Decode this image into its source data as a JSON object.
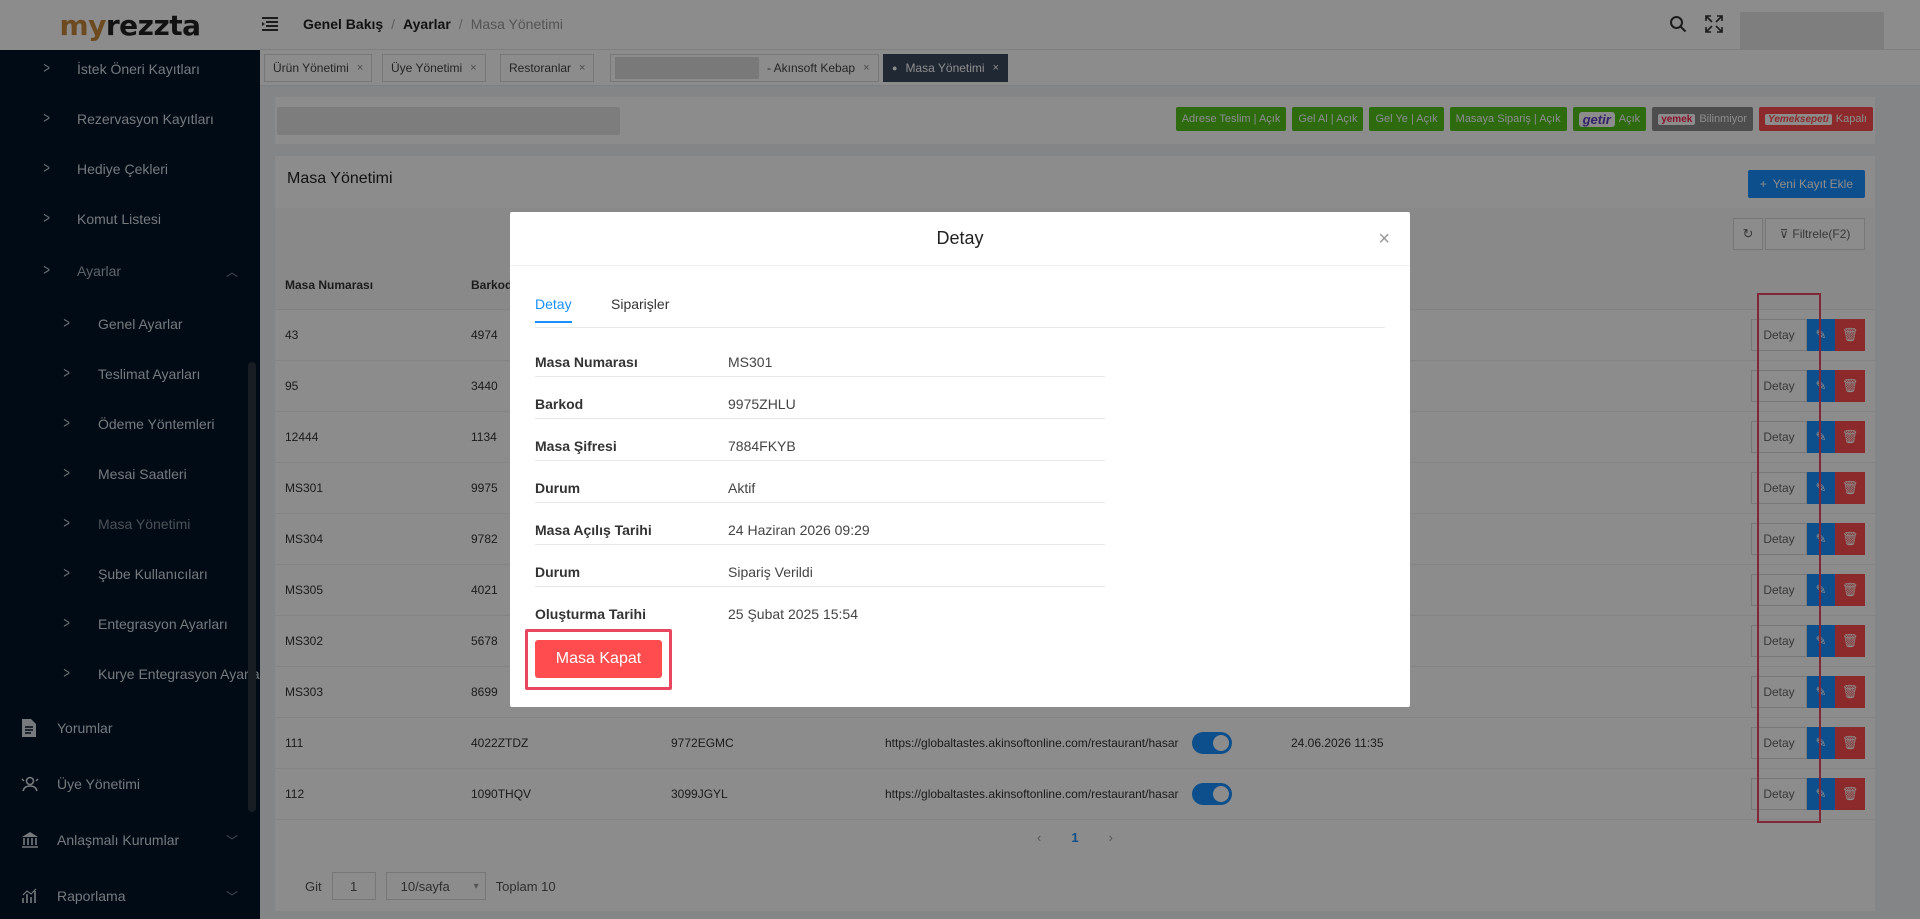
{
  "app": {
    "logo_part1": "my",
    "logo_part2": "rezzta"
  },
  "breadcrumb": [
    "Genel Bakış",
    "Ayarlar",
    "Masa Yönetimi"
  ],
  "sidebar": {
    "items": [
      {
        "label": "İstek Öneri Kayıtları"
      },
      {
        "label": "Rezervasyon Kayıtları"
      },
      {
        "label": "Hediye Çekleri"
      },
      {
        "label": "Komut Listesi"
      },
      {
        "label": "Ayarlar"
      },
      {
        "label": "Genel Ayarlar"
      },
      {
        "label": "Teslimat Ayarları"
      },
      {
        "label": "Ödeme Yöntemleri"
      },
      {
        "label": "Mesai Saatleri"
      },
      {
        "label": "Masa Yönetimi"
      },
      {
        "label": "Şube Kullanıcıları"
      },
      {
        "label": "Entegrasyon Ayarları"
      },
      {
        "label": "Kurye Entegrasyon Ayarları"
      },
      {
        "label": "Yorumlar"
      },
      {
        "label": "Üye Yönetimi"
      },
      {
        "label": "Anlaşmalı Kurumlar"
      },
      {
        "label": "Raporlama"
      }
    ]
  },
  "tabs": [
    {
      "label": "Ürün Yönetimi"
    },
    {
      "label": "Üye Yönetimi"
    },
    {
      "label": "Restoranlar"
    },
    {
      "label": "- Akınsoft Kebap"
    },
    {
      "label": "Masa Yönetimi"
    }
  ],
  "status_badges": [
    {
      "label": "Adrese Teslim | Açık",
      "color": "#52c41a"
    },
    {
      "label": "Gel Al | Açık",
      "color": "#52c41a"
    },
    {
      "label": "Gel Ye | Açık",
      "color": "#52c41a"
    },
    {
      "label": "Masaya Sipariş | Açık",
      "color": "#52c41a"
    },
    {
      "logo": "getir",
      "label": "Açık",
      "color": "#52c41a"
    },
    {
      "logo": "yemek",
      "label": "Bilinmiyor",
      "color": "#8c8c8c"
    },
    {
      "logo": "Yemeksepeti",
      "label": "Kapalı",
      "color": "#ff4d4f"
    }
  ],
  "page": {
    "title": "Masa Yönetimi",
    "add_button": "Yeni Kayıt Ekle",
    "filter_button": "Filtrele(F2)"
  },
  "table": {
    "headers": [
      "Masa Numarası",
      "Barkod"
    ],
    "rows": [
      {
        "no": "43",
        "barkod": "4974"
      },
      {
        "no": "95",
        "barkod": "3440"
      },
      {
        "no": "12444",
        "barkod": "1134"
      },
      {
        "no": "MS301",
        "barkod": "9975"
      },
      {
        "no": "MS304",
        "barkod": "9782"
      },
      {
        "no": "MS305",
        "barkod": "4021"
      },
      {
        "no": "MS302",
        "barkod": "5678"
      },
      {
        "no": "MS303",
        "barkod": "8699"
      },
      {
        "no": "111",
        "barkod": "4022ZTDZ",
        "sifre": "9772EGMC",
        "url": "https://globaltastes.akinsoftonline.com/restaurant/hasar",
        "date": "24.06.2026 11:35"
      },
      {
        "no": "112",
        "barkod": "1090THQV",
        "sifre": "3099JGYL",
        "url": "https://globaltastes.akinsoftonline.com/restaurant/hasar",
        "date": ""
      }
    ],
    "detail_label": "Detay"
  },
  "pagination": {
    "current": "1",
    "goto_label": "Git",
    "goto_value": "1",
    "per_page": "10/sayfa",
    "total": "Toplam 10"
  },
  "modal": {
    "title": "Detay",
    "tabs": [
      "Detay",
      "Siparişler"
    ],
    "fields": [
      {
        "key": "Masa Numarası",
        "value": "MS301"
      },
      {
        "key": "Barkod",
        "value": "9975ZHLU"
      },
      {
        "key": "Masa Şifresi",
        "value": "7884FKYB"
      },
      {
        "key": "Durum",
        "value": "Aktif"
      },
      {
        "key": "Masa Açılış Tarihi",
        "value": "24 Haziran 2026 09:29"
      },
      {
        "key": "Durum",
        "value": "Sipariş Verildi"
      },
      {
        "key": "Oluşturma Tarihi",
        "value": "25 Şubat 2025 15:54"
      }
    ],
    "close_table_button": "Masa Kapat"
  },
  "colors": {
    "primary": "#1890ff",
    "danger": "#ff4d4f",
    "success": "#52c41a",
    "sidebar": "#001529",
    "highlight": "#e8475f"
  }
}
